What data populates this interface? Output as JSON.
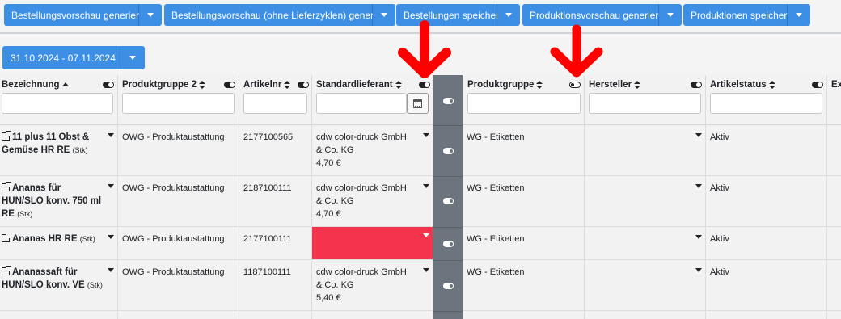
{
  "toolbar": {
    "buttons": [
      {
        "label": "Bestellungsvorschau generieren"
      },
      {
        "label": "Bestellungsvorschau (ohne Lieferzyklen) generieren"
      },
      {
        "label": "Bestellungen speichern"
      },
      {
        "label": "Produktionsvorschau generieren"
      },
      {
        "label": "Produktionen speichern"
      }
    ]
  },
  "date_filter": {
    "label": "31.10.2024 - 07.11.2024"
  },
  "columns": [
    {
      "label": "Bezeichnung",
      "sort": "asc",
      "toggle": "on"
    },
    {
      "label": "Produktgruppe 2",
      "sort": "both",
      "toggle": "on"
    },
    {
      "label": "Artikelnr",
      "sort": "both",
      "toggle": "on"
    },
    {
      "label": "Standardlieferant",
      "sort": "both",
      "toggle": "on"
    },
    {
      "label": "Produktgruppe",
      "sort": "both",
      "toggle": "off"
    },
    {
      "label": "Hersteller",
      "sort": "both",
      "toggle": "on"
    },
    {
      "label": "Artikelstatus",
      "sort": "both",
      "toggle": "on"
    },
    {
      "label": "Ex"
    }
  ],
  "rows": [
    {
      "name": "11 plus 11 Obst & Gemüse HR RE",
      "unit": "(Stk)",
      "group2": "OWG - Produktaustattung",
      "artnr": "2177100565",
      "supplier": "cdw color-druck GmbH & Co. KG",
      "price": "4,70 €",
      "group": "WG - Etiketten",
      "status": "Aktiv"
    },
    {
      "name": "Ananas für HUN/SLO konv. 750 ml RE",
      "unit": "(Stk)",
      "group2": "OWG - Produktaustattung",
      "artnr": "2187100111",
      "supplier": "cdw color-druck GmbH & Co. KG",
      "price": "4,70 €",
      "group": "WG - Etiketten",
      "status": "Aktiv"
    },
    {
      "name": "Ananas HR RE",
      "unit": "(Stk)",
      "group2": "OWG - Produktaustattung",
      "artnr": "2177100111",
      "supplier": "",
      "price": "",
      "group": "WG - Etiketten",
      "status": "Aktiv",
      "supplier_missing": true
    },
    {
      "name": "Ananassaft für HUN/SLO konv. VE",
      "unit": "(Stk)",
      "group2": "OWG - Produktaustattung",
      "artnr": "1187100111",
      "supplier": "cdw color-druck GmbH & Co. KG",
      "price": "5,40 €",
      "group": "WG - Etiketten",
      "status": "Aktiv"
    }
  ],
  "colors": {
    "primary": "#3d8fe6",
    "danger": "#f4334c",
    "dark_column": "#6c757d",
    "annotation_arrow": "#ff0000"
  },
  "icons": [
    "caret-down-icon",
    "filter-icon",
    "sort-icon",
    "toggle-icon",
    "calendar-icon",
    "external-link-icon",
    "down-arrow-annotation"
  ]
}
